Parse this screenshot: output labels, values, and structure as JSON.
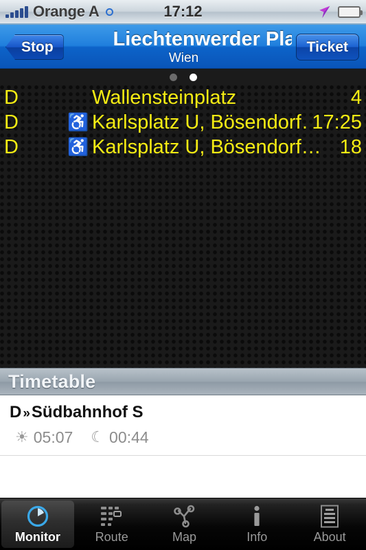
{
  "statusbar": {
    "carrier": "Orange A",
    "time": "17:12",
    "signal_icon": "signal-bars-icon",
    "bluetooth_icon": "bluetooth-circle-icon",
    "location_icon": "location-arrow-icon",
    "battery_icon": "battery-icon"
  },
  "navbar": {
    "back_label": "Stop",
    "title": "Liechtenwerder Pla",
    "subtitle": "Wien",
    "right_label": "Ticket"
  },
  "pager": {
    "total": 2,
    "active_index": 1
  },
  "board": {
    "rows": [
      {
        "line": "D",
        "accessible": false,
        "accessible_icon": "",
        "destination": "Wallensteinplatz",
        "time": "4"
      },
      {
        "line": "D",
        "accessible": true,
        "accessible_icon": "wheelchair-icon",
        "destination": "Karlsplatz U, Bösendorf…",
        "time": "17:25"
      },
      {
        "line": "D",
        "accessible": true,
        "accessible_icon": "wheelchair-icon",
        "destination": "Karlsplatz U, Bösendorf…",
        "time": "18"
      }
    ],
    "accessible_glyph": "♿",
    "text_color": "#f5ec13",
    "background_color": "#1a1a1a"
  },
  "timetable": {
    "header": "Timetable",
    "entry": {
      "line": "D",
      "arrow": "»",
      "destination": "Südbahnhof S",
      "first_icon": "sun-icon",
      "first_glyph": "☀",
      "first_time": "05:07",
      "last_icon": "moon-icon",
      "last_glyph": "☾",
      "last_time": "00:44"
    }
  },
  "tabbar": {
    "active_index": 0,
    "tabs": [
      {
        "label": "Monitor",
        "icon": "monitor-gauge-icon"
      },
      {
        "label": "Route",
        "icon": "route-grid-icon"
      },
      {
        "label": "Map",
        "icon": "map-network-icon"
      },
      {
        "label": "Info",
        "icon": "info-icon"
      },
      {
        "label": "About",
        "icon": "about-document-icon"
      }
    ]
  },
  "colors": {
    "accent_blue": "#1f7fdd",
    "board_yellow": "#f5ec13",
    "tab_active_blue": "#3aa8e8"
  }
}
